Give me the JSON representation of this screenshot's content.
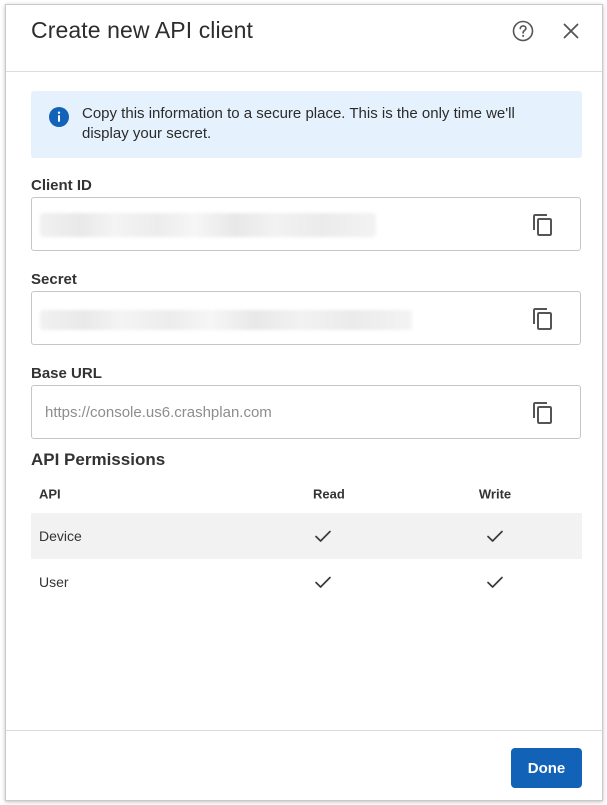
{
  "dialog": {
    "title": "Create new API client"
  },
  "banner": {
    "text": "Copy this information to a secure place. This is the only time we'll display your secret."
  },
  "fields": {
    "client_id": {
      "label": "Client ID",
      "value": ""
    },
    "secret": {
      "label": "Secret",
      "value": ""
    },
    "base_url": {
      "label": "Base URL",
      "value": "https://console.us6.crashplan.com"
    }
  },
  "permissions": {
    "heading": "API Permissions",
    "columns": [
      "API",
      "Read",
      "Write"
    ],
    "rows": [
      {
        "api": "Device",
        "read": true,
        "write": true
      },
      {
        "api": "User",
        "read": true,
        "write": true
      }
    ]
  },
  "footer": {
    "done_label": "Done"
  },
  "colors": {
    "primary": "#1262b8",
    "info_background": "#e5f1fc",
    "info_icon": "#1262b8",
    "row_stripe": "#f2f2f2"
  },
  "icons": {
    "help": "help-circle-icon",
    "close": "close-icon",
    "info": "info-icon",
    "copy": "copy-icon",
    "check": "check-icon"
  }
}
